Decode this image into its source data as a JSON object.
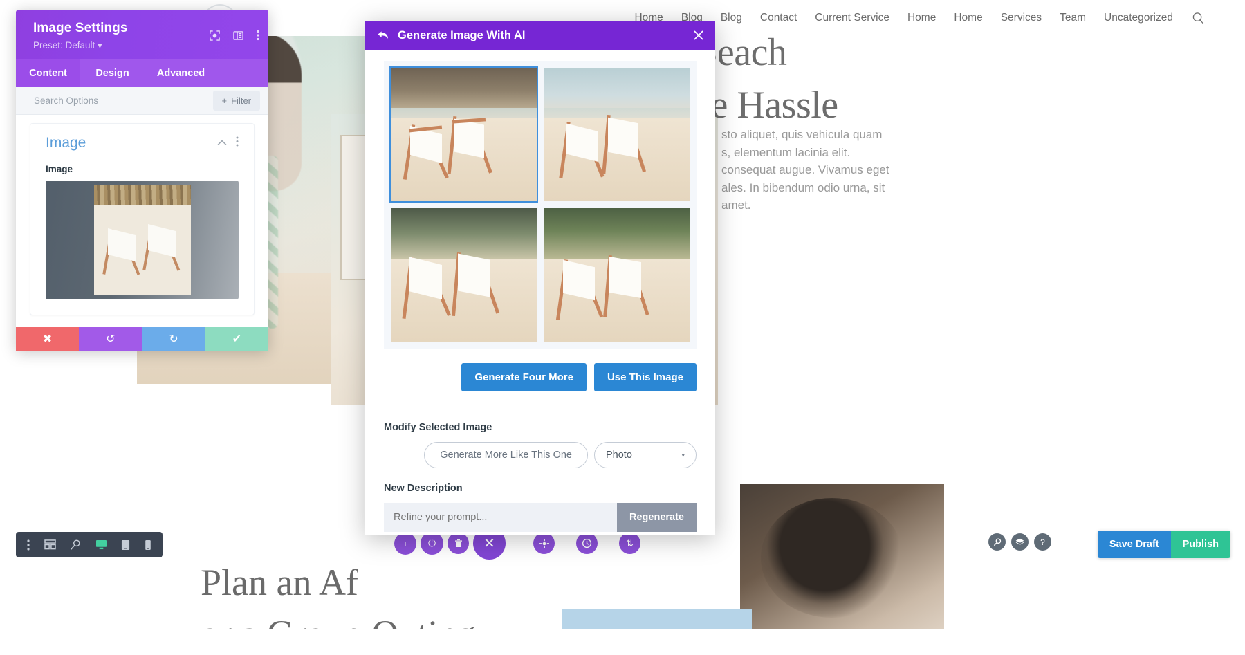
{
  "site": {
    "nav_items": [
      "Home",
      "Blog",
      "Blog",
      "Contact",
      "Current Service",
      "Home",
      "Home",
      "Services",
      "Team",
      "Uncategorized"
    ],
    "search_icon": "search-icon",
    "hero_heading": "Beach\nne Hassle",
    "hero_paragraph": "sto aliquet, quis vehicula quam\ns, elementum lacinia elit.\nconsequat augue. Vivamus eget\nales. In bibendum odio urna, sit\namet.",
    "plan_heading": "Plan an Af\nor a Group Outing"
  },
  "settings_panel": {
    "title": "Image Settings",
    "preset": "Preset: Default ▾",
    "head_icons": [
      "focus-target-icon",
      "layout-columns-icon",
      "more-vertical-icon"
    ],
    "tabs": [
      {
        "label": "Content",
        "active": true
      },
      {
        "label": "Design",
        "active": false
      },
      {
        "label": "Advanced",
        "active": false
      }
    ],
    "search_placeholder": "Search Options",
    "filter_label": "Filter",
    "card": {
      "title": "Image",
      "collapse_icon": "chevron-up-icon",
      "more_icon": "more-vertical-icon",
      "field_label": "Image"
    },
    "actions": [
      {
        "name": "cancel",
        "glyph": "✖",
        "color": "#f0686b"
      },
      {
        "name": "undo",
        "glyph": "↺",
        "color": "#a25ae8"
      },
      {
        "name": "redo",
        "glyph": "↻",
        "color": "#6bacea"
      },
      {
        "name": "save",
        "glyph": "✔",
        "color": "#8ddcc0"
      }
    ]
  },
  "ai_modal": {
    "title": "Generate Image With AI",
    "back_icon": "back-arrow-icon",
    "close_icon": "close-icon",
    "results": [
      {
        "id": 1,
        "alt": "beach chairs on sand with rocky cliff",
        "selected": true
      },
      {
        "id": 2,
        "alt": "two beach chairs near shoreline",
        "selected": false
      },
      {
        "id": 3,
        "alt": "beach chairs with dark foliage background",
        "selected": false
      },
      {
        "id": 4,
        "alt": "beach chairs near green cliff",
        "selected": false
      }
    ],
    "generate_more_label": "Generate Four More",
    "use_image_label": "Use This Image",
    "modify_section_label": "Modify Selected Image",
    "generate_more_like_label": "Generate More Like This One",
    "style_select_value": "Photo",
    "style_caret": "▾",
    "new_description_label": "New Description",
    "prompt_placeholder": "Refine your prompt...",
    "regenerate_label": "Regenerate"
  },
  "builder_bar": {
    "left_tools": [
      {
        "name": "more-vertical-icon",
        "active": false
      },
      {
        "name": "wireframe-icon",
        "active": false
      },
      {
        "name": "search-zoom-icon",
        "active": false
      },
      {
        "name": "desktop-icon",
        "active": true
      },
      {
        "name": "tablet-icon",
        "active": false
      },
      {
        "name": "phone-icon",
        "active": false
      }
    ],
    "center_tools": [
      {
        "name": "add-icon",
        "glyph": "+"
      },
      {
        "name": "power-icon",
        "glyph": "⏻"
      },
      {
        "name": "trash-icon",
        "glyph": "🗑"
      },
      {
        "name": "close-icon",
        "glyph": "✕"
      },
      {
        "name": "settings-gear-icon",
        "glyph": "✿"
      },
      {
        "name": "history-clock-icon",
        "glyph": "◷"
      },
      {
        "name": "sort-updown-icon",
        "glyph": "⇅"
      }
    ],
    "right_mini": [
      {
        "name": "search-zoom-icon",
        "glyph": "⌕"
      },
      {
        "name": "layers-icon",
        "glyph": "≋"
      },
      {
        "name": "help-icon",
        "glyph": "?"
      }
    ],
    "save_draft_label": "Save Draft",
    "publish_label": "Publish"
  },
  "colors": {
    "panel_purple": "#9346ea",
    "modal_purple": "#7626d4",
    "accent_blue": "#2b87d4",
    "publish_green": "#2fc495",
    "selected_outline": "#3f8fdc"
  }
}
